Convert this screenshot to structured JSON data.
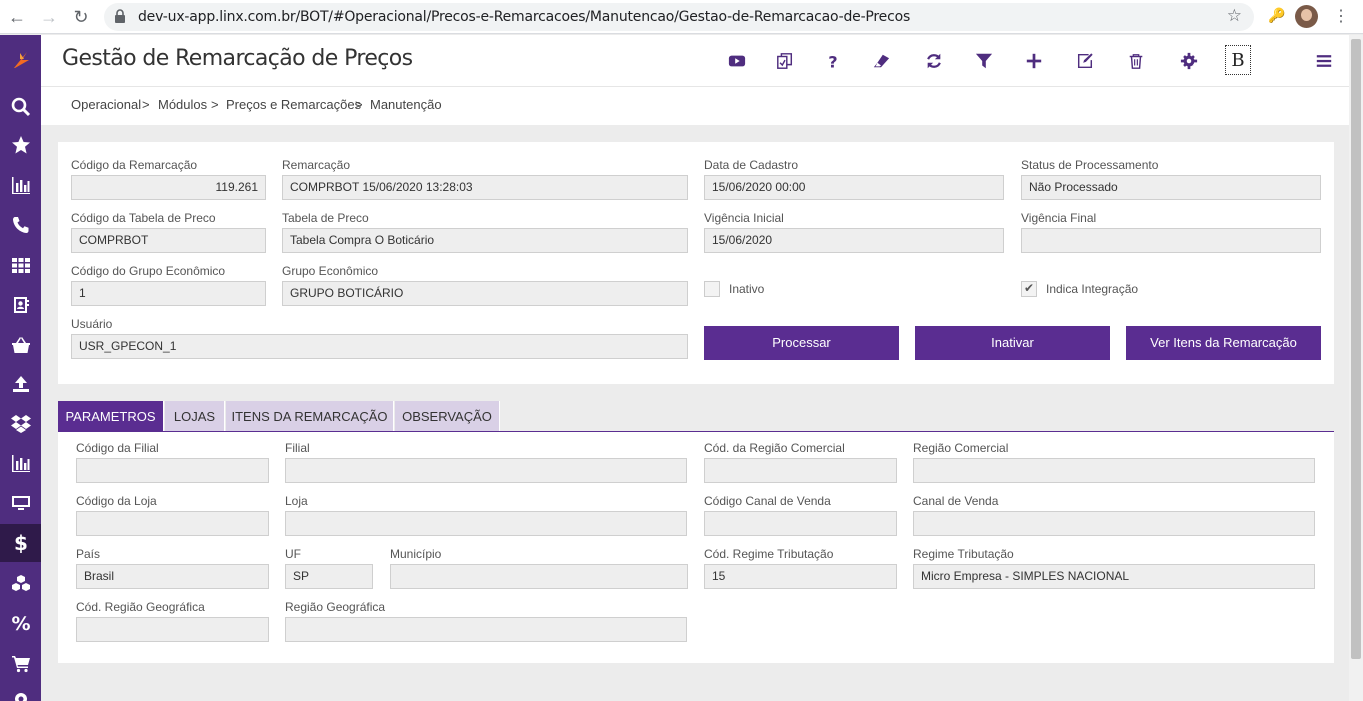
{
  "browser": {
    "url": "dev-ux-app.linx.com.br/BOT/#Operacional/Precos-e-Remarcacoes/Manutencao/Gestao-de-Remarcacao-de-Precos"
  },
  "header": {
    "title": "Gestão de Remarcação de Preços",
    "b_label": "B"
  },
  "breadcrumb": {
    "items": [
      "Operacional",
      "Módulos",
      "Preços e Remarcações",
      "Manutenção"
    ],
    "separator": ">"
  },
  "form": {
    "codigo_remarcacao": {
      "label": "Código da Remarcação",
      "value": "119.261"
    },
    "remarcacao": {
      "label": "Remarcação",
      "value": "COMPRBOT 15/06/2020 13:28:03"
    },
    "data_cadastro": {
      "label": "Data de Cadastro",
      "value": "15/06/2020 00:00"
    },
    "status_processamento": {
      "label": "Status de Processamento",
      "value": "Não Processado"
    },
    "codigo_tabela_preco": {
      "label": "Código da Tabela de Preco",
      "value": "COMPRBOT"
    },
    "tabela_preco": {
      "label": "Tabela de Preco",
      "value": "Tabela Compra O Boticário"
    },
    "vigencia_inicial": {
      "label": "Vigência Inicial",
      "value": "15/06/2020"
    },
    "vigencia_final": {
      "label": "Vigência Final",
      "value": ""
    },
    "codigo_grupo_economico": {
      "label": "Código do Grupo Econômico",
      "value": "1"
    },
    "grupo_economico": {
      "label": "Grupo Econômico",
      "value": "GRUPO BOTICÁRIO"
    },
    "inativo": {
      "label": "Inativo",
      "checked": false
    },
    "indica_integracao": {
      "label": "Indica Integração",
      "checked": true
    },
    "usuario": {
      "label": "Usuário",
      "value": "USR_GPECON_1"
    },
    "buttons": {
      "processar": "Processar",
      "inativar": "Inativar",
      "ver_itens": "Ver Itens da Remarcação"
    }
  },
  "tabs": [
    {
      "label": "PARAMETROS",
      "active": true
    },
    {
      "label": "LOJAS",
      "active": false
    },
    {
      "label": "ITENS DA REMARCAÇÃO",
      "active": false
    },
    {
      "label": "OBSERVAÇÃO",
      "active": false
    }
  ],
  "params": {
    "codigo_filial": {
      "label": "Código da Filial",
      "value": ""
    },
    "filial": {
      "label": "Filial",
      "value": ""
    },
    "cod_regiao_comercial": {
      "label": "Cód. da Região Comercial",
      "value": ""
    },
    "regiao_comercial": {
      "label": "Região Comercial",
      "value": ""
    },
    "codigo_loja": {
      "label": "Código da Loja",
      "value": ""
    },
    "loja": {
      "label": "Loja",
      "value": ""
    },
    "codigo_canal_venda": {
      "label": "Código Canal de Venda",
      "value": ""
    },
    "canal_venda": {
      "label": "Canal de Venda",
      "value": ""
    },
    "pais": {
      "label": "País",
      "value": "Brasil"
    },
    "uf": {
      "label": "UF",
      "value": "SP"
    },
    "municipio": {
      "label": "Município",
      "value": ""
    },
    "cod_regime_tributacao": {
      "label": "Cód. Regime Tributação",
      "value": "15"
    },
    "regime_tributacao": {
      "label": "Regime Tributação",
      "value": "Micro Empresa - SIMPLES NACIONAL"
    },
    "cod_regiao_geografica": {
      "label": "Cód. Região Geográfica",
      "value": ""
    },
    "regiao_geografica": {
      "label": "Região Geográfica",
      "value": ""
    }
  },
  "colors": {
    "brand": "#5a2d91",
    "sidebar": "#4f2d7f",
    "tab_inactive": "#d9d0e6"
  }
}
